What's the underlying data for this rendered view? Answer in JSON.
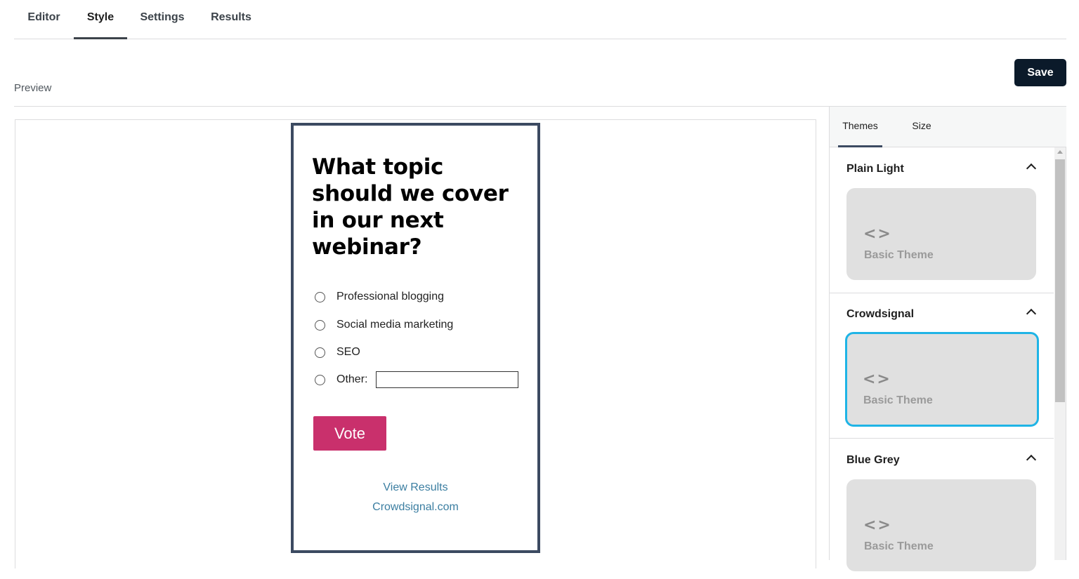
{
  "nav": {
    "tabs": [
      {
        "label": "Editor"
      },
      {
        "label": "Style"
      },
      {
        "label": "Settings"
      },
      {
        "label": "Results"
      }
    ],
    "active": "Style"
  },
  "toolbar": {
    "save_label": "Save"
  },
  "preview": {
    "label": "Preview"
  },
  "poll": {
    "question": "What topic should we cover in our next webinar?",
    "options": [
      {
        "label": "Professional blogging"
      },
      {
        "label": "Social media marketing"
      },
      {
        "label": "SEO"
      },
      {
        "label": "Other:"
      }
    ],
    "other_input_value": "",
    "vote_label": "Vote",
    "view_results_label": "View Results",
    "branding_label": "Crowdsignal.com"
  },
  "panel": {
    "tabs": [
      {
        "label": "Themes"
      },
      {
        "label": "Size"
      }
    ],
    "active_tab": "Themes",
    "sections": [
      {
        "title": "Plain Light",
        "card_label": "Basic Theme",
        "selected": false
      },
      {
        "title": "Crowdsignal",
        "card_label": "Basic Theme",
        "selected": true
      },
      {
        "title": "Blue Grey",
        "card_label": "Basic Theme",
        "selected": false
      }
    ]
  },
  "colors": {
    "save_button": "#0b1a2a",
    "vote_button": "#c9306c",
    "poll_border": "#3c4a61",
    "link": "#3b7ea1",
    "selected_theme": "#1fb4e6"
  },
  "icons": {
    "theme_card": "code-brackets-icon",
    "section_toggle": "chevron-up-icon"
  }
}
